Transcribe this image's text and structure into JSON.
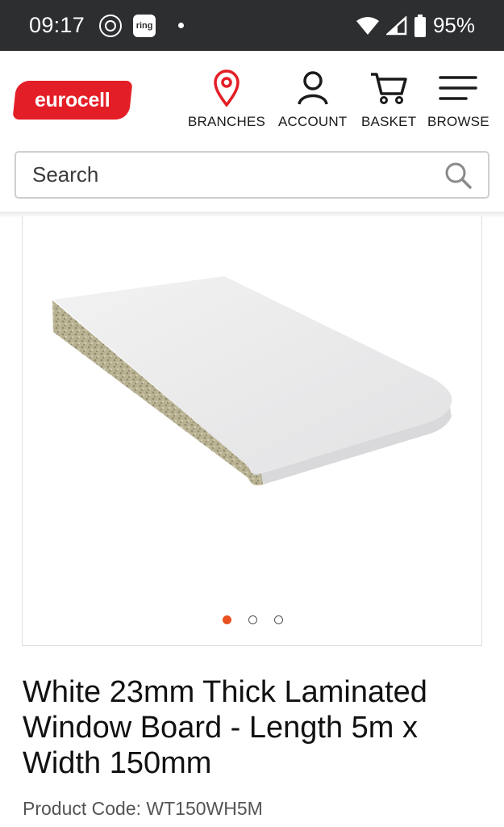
{
  "status_bar": {
    "time": "09:17",
    "ring_label": "ring",
    "battery": "95%"
  },
  "header": {
    "logo_text": "eurocell",
    "nav": [
      {
        "label": "BRANCHES",
        "icon": "location-pin-icon"
      },
      {
        "label": "ACCOUNT",
        "icon": "user-icon"
      },
      {
        "label": "BASKET",
        "icon": "cart-icon"
      },
      {
        "label": "BROWSE",
        "icon": "menu-icon"
      }
    ]
  },
  "search": {
    "placeholder": "Search"
  },
  "carousel": {
    "total": 3,
    "active_index": 0
  },
  "product": {
    "title": "White 23mm Thick Laminated Window Board - Length 5m x Width 150mm",
    "code_label": "Product Code: WT150WH5M"
  },
  "colors": {
    "brand": "#e41e26",
    "accent_dot": "#e8511f",
    "status_bar": "#2d2e30"
  }
}
